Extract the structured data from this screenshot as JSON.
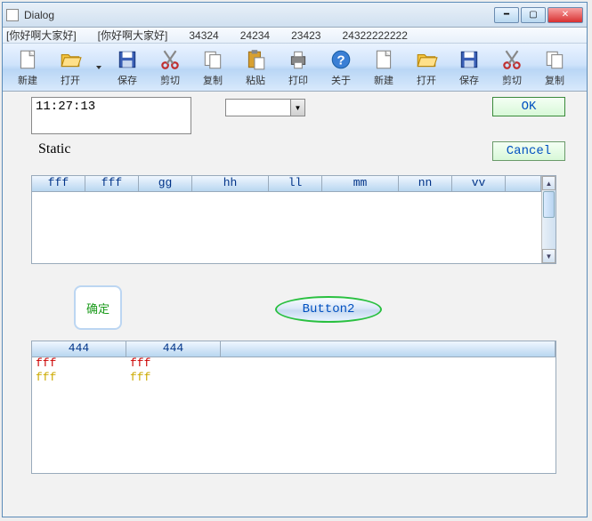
{
  "title": "Dialog",
  "menu": {
    "m0": "[你好啊大家好]",
    "m1": "[你好啊大家好]",
    "m2": "34324",
    "m3": "24234",
    "m4": "23423",
    "m5": "24322222222"
  },
  "toolbar": [
    {
      "label": "新建",
      "icon": "new"
    },
    {
      "label": "打开",
      "icon": "open"
    },
    {
      "label": "",
      "icon": "drop"
    },
    {
      "label": "保存",
      "icon": "save"
    },
    {
      "label": "剪切",
      "icon": "cut"
    },
    {
      "label": "复制",
      "icon": "copy"
    },
    {
      "label": "粘贴",
      "icon": "paste"
    },
    {
      "label": "打印",
      "icon": "print"
    },
    {
      "label": "关于",
      "icon": "help"
    },
    {
      "label": "新建",
      "icon": "new"
    },
    {
      "label": "打开",
      "icon": "open"
    },
    {
      "label": "保存",
      "icon": "save"
    },
    {
      "label": "剪切",
      "icon": "cut"
    },
    {
      "label": "复制",
      "icon": "copy"
    }
  ],
  "time": "11:27:13",
  "static_label": "Static",
  "buttons": {
    "ok": "OK",
    "cancel": "Cancel",
    "confirm": "确定",
    "button2": "Button2"
  },
  "grid1": {
    "cols": [
      "fff",
      "fff",
      "gg",
      "hh",
      "ll",
      "mm",
      "nn",
      "vv"
    ]
  },
  "grid2": {
    "cols": [
      "444",
      "444"
    ],
    "rows": [
      {
        "cells": [
          "fff",
          "fff"
        ],
        "color": "r-red"
      },
      {
        "cells": [
          "fff",
          "fff"
        ],
        "color": "r-yel"
      }
    ]
  }
}
